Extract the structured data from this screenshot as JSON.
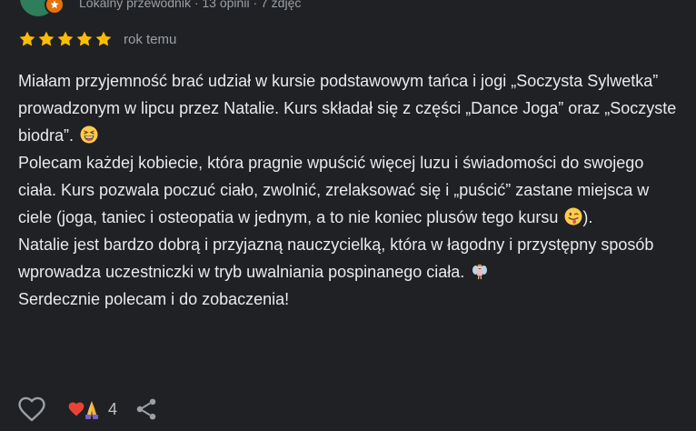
{
  "review": {
    "author_meta": "Lokalny przewodnik · 13 opinii · 7 zdjęć",
    "rating": 5,
    "date": "rok temu",
    "paragraphs": [
      {
        "text": "Miałam przyjemność brać udział w kursie podstawowym tańca i jogi „Soczysta Sylwetka” prowadzonym w lipcu przez Natalie. Kurs składał się z części „Dance Joga” oraz „Soczyste biodra”. ",
        "emoji": "grinning-squinting-face",
        "after": ""
      },
      {
        "text": "Polecam każdej kobiecie, która pragnie wpuścić więcej luzu i świadomości do swojego ciała. Kurs pozwala poczuć ciało, zwolnić, zrelaksować się i „puścić” zastane miejsca w ciele (joga, taniec i osteopatia w jednym, a to nie koniec plusów tego kursu ",
        "emoji": "winking-tongue-face",
        "after": ")."
      },
      {
        "text": "Natalie jest bardzo dobrą i przyjazną nauczycielką, która w łagodny i przystępny sposób wprowadza uczestniczki w tryb uwalniania pospinanego ciała. ",
        "emoji": "fairy",
        "after": ""
      },
      {
        "text": "Serdecznie polecam i do zobaczenia!",
        "emoji": "",
        "after": ""
      }
    ],
    "reaction_count": "4"
  },
  "colors": {
    "background": "#202124",
    "text": "#e8eaed",
    "muted": "#9aa0a6",
    "star": "#fbbc04",
    "heart": "#ea4335"
  }
}
